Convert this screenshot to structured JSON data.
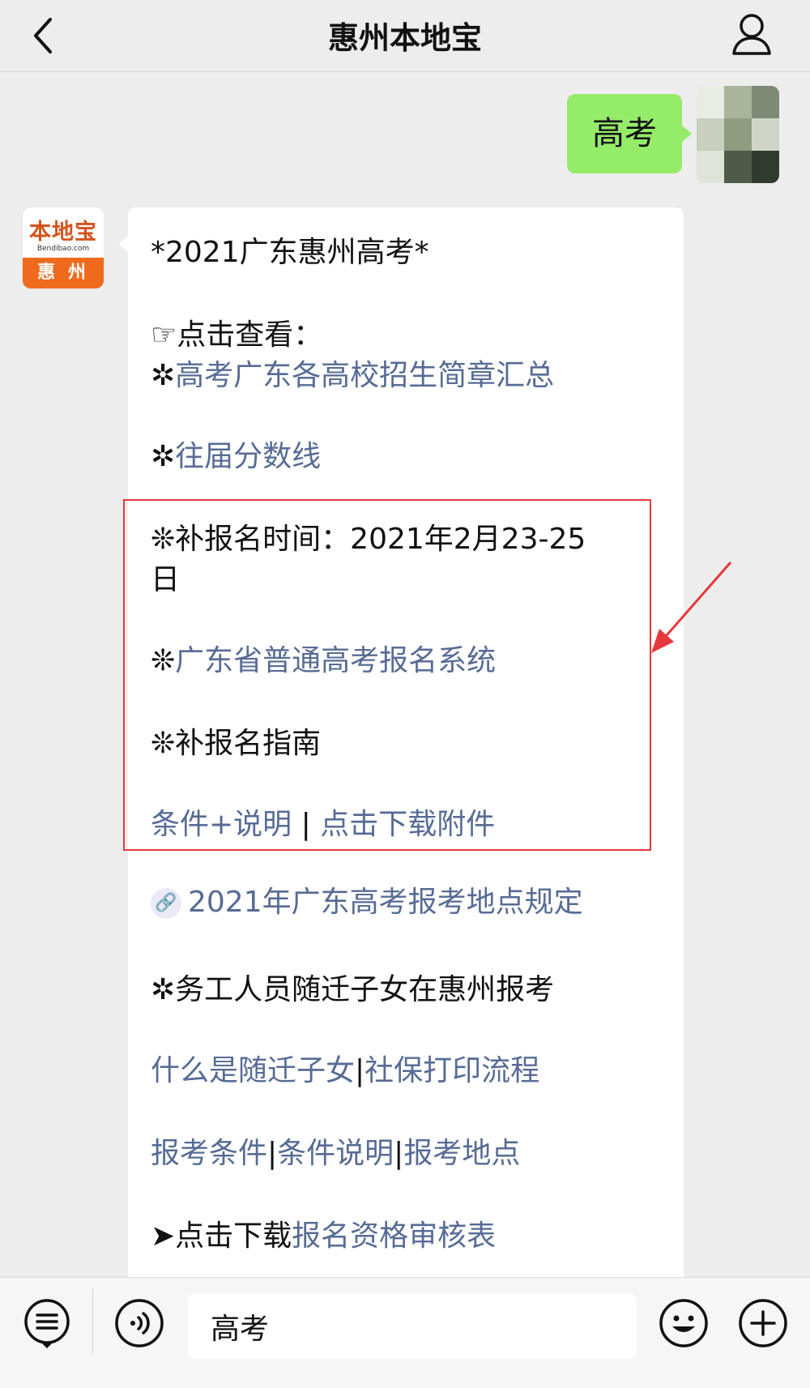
{
  "header": {
    "title": "惠州本地宝"
  },
  "user_message": {
    "text": "高考"
  },
  "bot_avatar": {
    "logo_text": "本地宝",
    "logo_url": "Bendibao.com",
    "city": "惠 州"
  },
  "bot_message": {
    "heading": "*2021广东惠州高考*",
    "view_prefix": "☞点击查看：",
    "bullet1_mark": "✲",
    "link_brochures": "高考广东各高校招生简章汇总",
    "bullet2_mark": "✲",
    "link_past_scores": "往届分数线",
    "supp_time_line1": "❊补报名时间：2021年2月23-25",
    "supp_time_line2": "日",
    "bullet3_mark": "❊",
    "link_reg_system": "广东省普通高考报名系统",
    "supp_guide": "❊补报名指南",
    "link_conditions": "条件+说明",
    "sep1": " | ",
    "link_download": "点击下载附件",
    "miniprog_icon": "link-icon",
    "link_exam_location_rules": "2021年广东高考报考地点规定",
    "migrant_heading": "✲务工人员随迁子女在惠州报考",
    "link_what_is": "什么是随迁子女",
    "sep2": "|",
    "link_social_security": "社保打印流程",
    "link_exam_conditions": "报考条件",
    "sep3": "|",
    "link_condition_notes": "条件说明",
    "sep4": "|",
    "link_exam_location": "报考地点",
    "download_prefix": "➤点击下载",
    "link_review_form": "报名资格审核表"
  },
  "input": {
    "value": "高考"
  },
  "colors": {
    "link": "#576b95",
    "user_bubble": "#95ec69",
    "highlight": "#e4393c"
  }
}
